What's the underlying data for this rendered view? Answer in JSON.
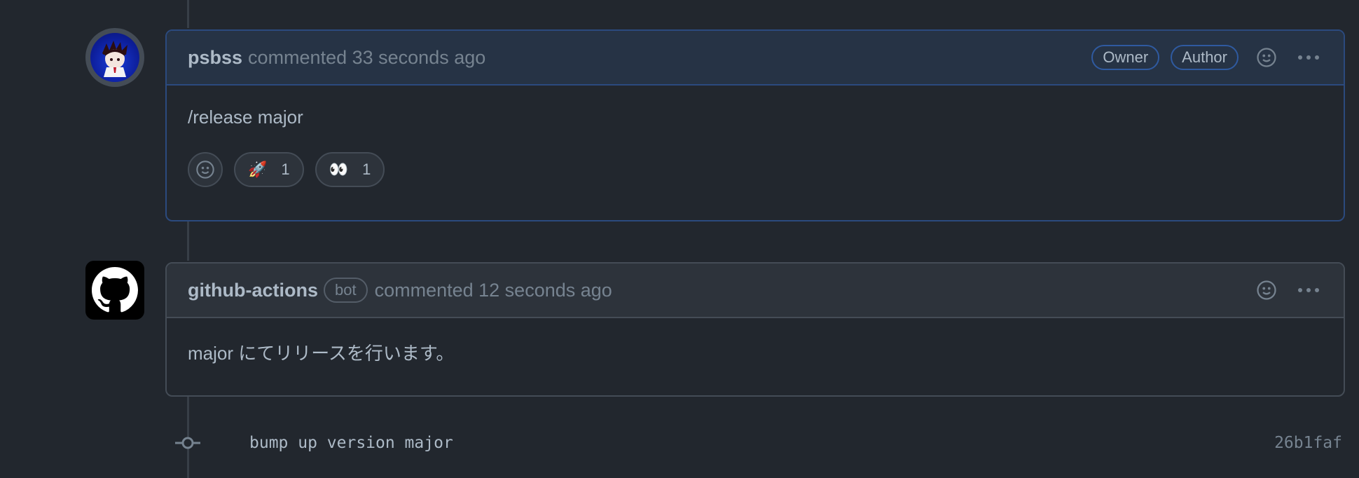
{
  "comments": [
    {
      "author": "psbss",
      "meta": "commented 33 seconds ago",
      "labels": [
        "Owner",
        "Author"
      ],
      "body": "/release major",
      "reactions": [
        {
          "emoji": "🚀",
          "count": "1"
        },
        {
          "emoji": "👀",
          "count": "1"
        }
      ]
    },
    {
      "author": "github-actions",
      "bot_label": "bot",
      "meta": "commented 12 seconds ago",
      "body": "major にてリリースを行います。"
    }
  ],
  "commit": {
    "message": "bump up version major",
    "sha": "26b1faf"
  },
  "icons": {
    "smiley": "smiley-icon",
    "kebab": "kebab-horizontal-icon",
    "commit": "git-commit-icon",
    "github": "github-mark-icon"
  },
  "colors": {
    "background": "#22272e",
    "owner_border": "#2b4a7e",
    "owner_header": "#263345",
    "border": "#444c56"
  }
}
